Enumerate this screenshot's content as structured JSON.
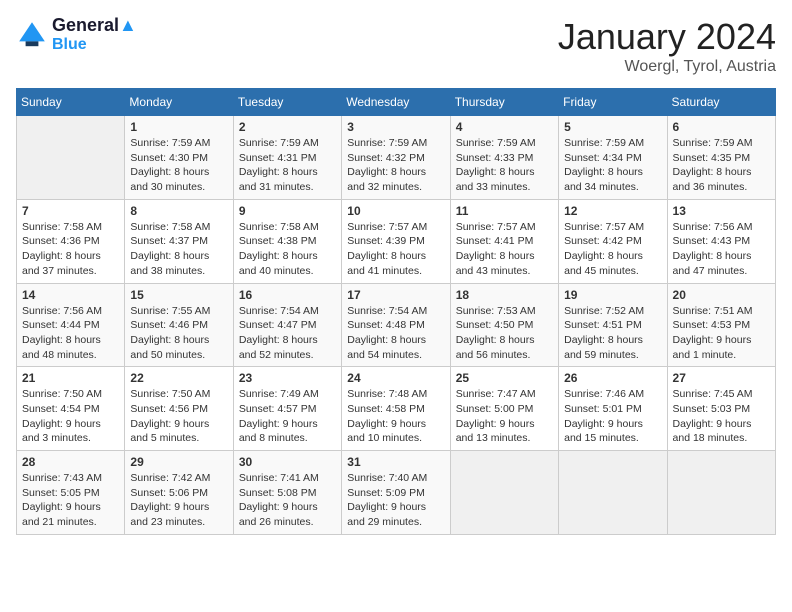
{
  "header": {
    "logo_line1": "General",
    "logo_line2": "Blue",
    "month": "January 2024",
    "location": "Woergl, Tyrol, Austria"
  },
  "days_of_week": [
    "Sunday",
    "Monday",
    "Tuesday",
    "Wednesday",
    "Thursday",
    "Friday",
    "Saturday"
  ],
  "weeks": [
    [
      {
        "day": "",
        "text": ""
      },
      {
        "day": "1",
        "text": "Sunrise: 7:59 AM\nSunset: 4:30 PM\nDaylight: 8 hours\nand 30 minutes."
      },
      {
        "day": "2",
        "text": "Sunrise: 7:59 AM\nSunset: 4:31 PM\nDaylight: 8 hours\nand 31 minutes."
      },
      {
        "day": "3",
        "text": "Sunrise: 7:59 AM\nSunset: 4:32 PM\nDaylight: 8 hours\nand 32 minutes."
      },
      {
        "day": "4",
        "text": "Sunrise: 7:59 AM\nSunset: 4:33 PM\nDaylight: 8 hours\nand 33 minutes."
      },
      {
        "day": "5",
        "text": "Sunrise: 7:59 AM\nSunset: 4:34 PM\nDaylight: 8 hours\nand 34 minutes."
      },
      {
        "day": "6",
        "text": "Sunrise: 7:59 AM\nSunset: 4:35 PM\nDaylight: 8 hours\nand 36 minutes."
      }
    ],
    [
      {
        "day": "7",
        "text": "Sunrise: 7:58 AM\nSunset: 4:36 PM\nDaylight: 8 hours\nand 37 minutes."
      },
      {
        "day": "8",
        "text": "Sunrise: 7:58 AM\nSunset: 4:37 PM\nDaylight: 8 hours\nand 38 minutes."
      },
      {
        "day": "9",
        "text": "Sunrise: 7:58 AM\nSunset: 4:38 PM\nDaylight: 8 hours\nand 40 minutes."
      },
      {
        "day": "10",
        "text": "Sunrise: 7:57 AM\nSunset: 4:39 PM\nDaylight: 8 hours\nand 41 minutes."
      },
      {
        "day": "11",
        "text": "Sunrise: 7:57 AM\nSunset: 4:41 PM\nDaylight: 8 hours\nand 43 minutes."
      },
      {
        "day": "12",
        "text": "Sunrise: 7:57 AM\nSunset: 4:42 PM\nDaylight: 8 hours\nand 45 minutes."
      },
      {
        "day": "13",
        "text": "Sunrise: 7:56 AM\nSunset: 4:43 PM\nDaylight: 8 hours\nand 47 minutes."
      }
    ],
    [
      {
        "day": "14",
        "text": "Sunrise: 7:56 AM\nSunset: 4:44 PM\nDaylight: 8 hours\nand 48 minutes."
      },
      {
        "day": "15",
        "text": "Sunrise: 7:55 AM\nSunset: 4:46 PM\nDaylight: 8 hours\nand 50 minutes."
      },
      {
        "day": "16",
        "text": "Sunrise: 7:54 AM\nSunset: 4:47 PM\nDaylight: 8 hours\nand 52 minutes."
      },
      {
        "day": "17",
        "text": "Sunrise: 7:54 AM\nSunset: 4:48 PM\nDaylight: 8 hours\nand 54 minutes."
      },
      {
        "day": "18",
        "text": "Sunrise: 7:53 AM\nSunset: 4:50 PM\nDaylight: 8 hours\nand 56 minutes."
      },
      {
        "day": "19",
        "text": "Sunrise: 7:52 AM\nSunset: 4:51 PM\nDaylight: 8 hours\nand 59 minutes."
      },
      {
        "day": "20",
        "text": "Sunrise: 7:51 AM\nSunset: 4:53 PM\nDaylight: 9 hours\nand 1 minute."
      }
    ],
    [
      {
        "day": "21",
        "text": "Sunrise: 7:50 AM\nSunset: 4:54 PM\nDaylight: 9 hours\nand 3 minutes."
      },
      {
        "day": "22",
        "text": "Sunrise: 7:50 AM\nSunset: 4:56 PM\nDaylight: 9 hours\nand 5 minutes."
      },
      {
        "day": "23",
        "text": "Sunrise: 7:49 AM\nSunset: 4:57 PM\nDaylight: 9 hours\nand 8 minutes."
      },
      {
        "day": "24",
        "text": "Sunrise: 7:48 AM\nSunset: 4:58 PM\nDaylight: 9 hours\nand 10 minutes."
      },
      {
        "day": "25",
        "text": "Sunrise: 7:47 AM\nSunset: 5:00 PM\nDaylight: 9 hours\nand 13 minutes."
      },
      {
        "day": "26",
        "text": "Sunrise: 7:46 AM\nSunset: 5:01 PM\nDaylight: 9 hours\nand 15 minutes."
      },
      {
        "day": "27",
        "text": "Sunrise: 7:45 AM\nSunset: 5:03 PM\nDaylight: 9 hours\nand 18 minutes."
      }
    ],
    [
      {
        "day": "28",
        "text": "Sunrise: 7:43 AM\nSunset: 5:05 PM\nDaylight: 9 hours\nand 21 minutes."
      },
      {
        "day": "29",
        "text": "Sunrise: 7:42 AM\nSunset: 5:06 PM\nDaylight: 9 hours\nand 23 minutes."
      },
      {
        "day": "30",
        "text": "Sunrise: 7:41 AM\nSunset: 5:08 PM\nDaylight: 9 hours\nand 26 minutes."
      },
      {
        "day": "31",
        "text": "Sunrise: 7:40 AM\nSunset: 5:09 PM\nDaylight: 9 hours\nand 29 minutes."
      },
      {
        "day": "",
        "text": ""
      },
      {
        "day": "",
        "text": ""
      },
      {
        "day": "",
        "text": ""
      }
    ]
  ]
}
